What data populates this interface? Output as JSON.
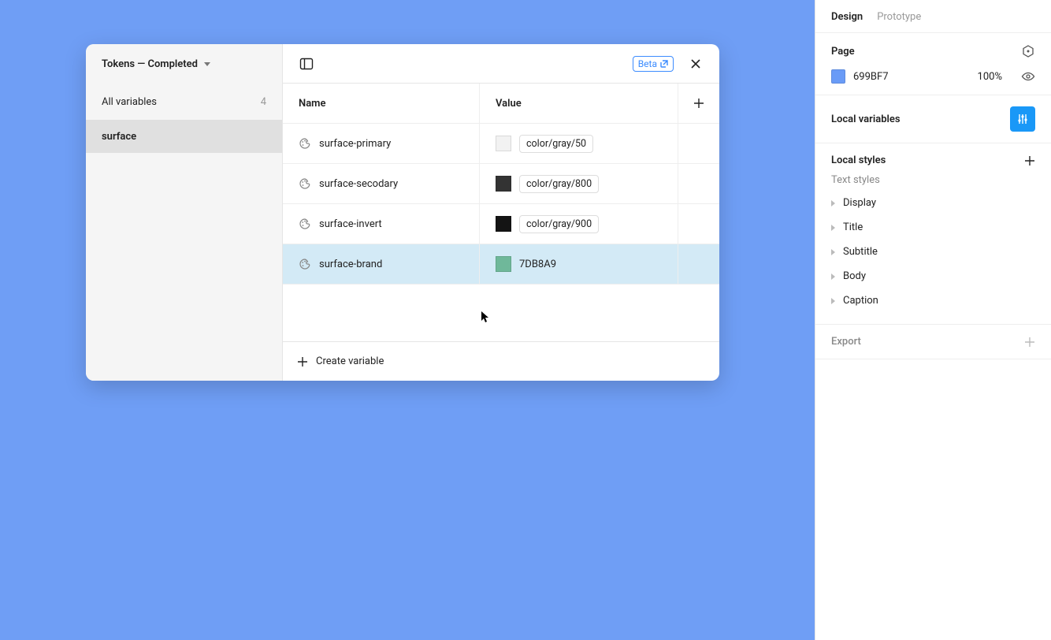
{
  "dialog": {
    "collection_title": "Tokens — Completed",
    "all_variables_label": "All variables",
    "all_variables_count": "4",
    "selected_group": "surface",
    "beta_label": "Beta",
    "columns": {
      "name": "Name",
      "value": "Value"
    },
    "rows": [
      {
        "name": "surface-primary",
        "swatch": "#f2f2f2",
        "chip": "color/gray/50",
        "is_chip": true,
        "selected": false
      },
      {
        "name": "surface-secodary",
        "swatch": "#333333",
        "chip": "color/gray/800",
        "is_chip": true,
        "selected": false
      },
      {
        "name": "surface-invert",
        "swatch": "#141414",
        "chip": "color/gray/900",
        "is_chip": true,
        "selected": false
      },
      {
        "name": "surface-brand",
        "swatch": "#6fb89a",
        "chip": "7DB8A9",
        "is_chip": false,
        "selected": true
      }
    ],
    "create_label": "Create variable"
  },
  "sidebar": {
    "tabs": {
      "design": "Design",
      "prototype": "Prototype"
    },
    "page": {
      "title": "Page",
      "color_hex": "699BF7",
      "swatch": "#699BF7",
      "opacity": "100%"
    },
    "local_variables_title": "Local variables",
    "local_styles_title": "Local styles",
    "text_styles_label": "Text styles",
    "text_styles": [
      "Display",
      "Title",
      "Subtitle",
      "Body",
      "Caption"
    ],
    "export_title": "Export"
  }
}
